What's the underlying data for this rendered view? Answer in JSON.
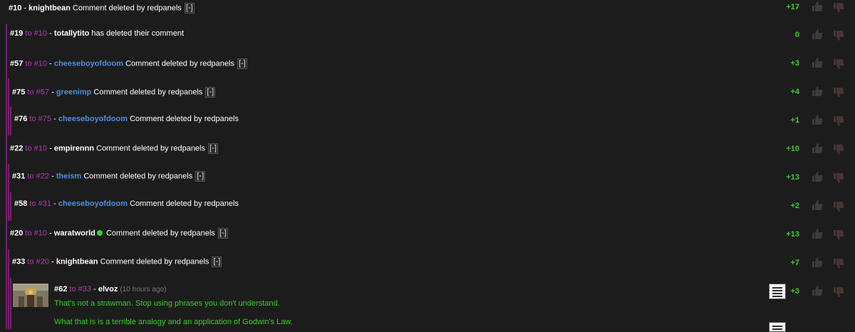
{
  "comments": [
    {
      "num": "#10",
      "to": "",
      "user": "knightbean",
      "user_blue": false,
      "msg": "Comment deleted by redpanels",
      "collapse": "[-]",
      "score": "+17",
      "online": false
    },
    {
      "num": "#19",
      "to": "#10",
      "user": "totallytito",
      "user_blue": false,
      "msg": "has deleted their comment",
      "collapse": "",
      "score": "0",
      "online": false
    },
    {
      "num": "#57",
      "to": "#10",
      "user": "cheeseboyofdoom",
      "user_blue": true,
      "msg": "Comment deleted by redpanels",
      "collapse": "[-]",
      "score": "+3",
      "online": false
    },
    {
      "num": "#75",
      "to": "#57",
      "user": "greenimp",
      "user_blue": true,
      "msg": "Comment deleted by redpanels",
      "collapse": "[-]",
      "score": "+4",
      "online": false
    },
    {
      "num": "#76",
      "to": "#75",
      "user": "cheeseboyofdoom",
      "user_blue": true,
      "msg": "Comment deleted by redpanels",
      "collapse": "",
      "score": "+1",
      "online": false
    },
    {
      "num": "#22",
      "to": "#10",
      "user": "empirennn",
      "user_blue": false,
      "msg": "Comment deleted by redpanels",
      "collapse": "[-]",
      "score": "+10",
      "online": false
    },
    {
      "num": "#31",
      "to": "#22",
      "user": "theism",
      "user_blue": true,
      "msg": "Comment deleted by redpanels",
      "collapse": "[-]",
      "score": "+13",
      "online": false
    },
    {
      "num": "#58",
      "to": "#31",
      "user": "cheeseboyofdoom",
      "user_blue": true,
      "msg": "Comment deleted by redpanels",
      "collapse": "",
      "score": "+2",
      "online": false
    },
    {
      "num": "#20",
      "to": "#10",
      "user": "waratworld",
      "user_blue": false,
      "msg": "Comment deleted by redpanels",
      "collapse": "[-]",
      "score": "+13",
      "online": true
    },
    {
      "num": "#33",
      "to": "#20",
      "user": "knightbean",
      "user_blue": false,
      "msg": "Comment deleted by redpanels",
      "collapse": "[-]",
      "score": "+7",
      "online": false
    }
  ],
  "last_comment": {
    "num": "#62",
    "to": "#33",
    "user": "elvoz",
    "time": "(10 hours ago)",
    "line1": "That's not a strawman. Stop using phrases you don't understand.",
    "line2": "What that is is a terrible analogy and an application of Godwin's Law.",
    "score": "+3"
  },
  "labels": {
    "to": "to",
    "sep": "-"
  },
  "colors": {
    "score": "#3ecb2f",
    "reply_link": "#b33ab0",
    "user_link": "#4d8fdb",
    "thread_bar": "#7a1f6f",
    "online_dot": "#2bd62b"
  },
  "icons": {
    "upvote": "thumbs-up-icon",
    "downvote": "thumbs-down-icon",
    "menu": "menu-lines-icon",
    "collapse": "collapse-icon",
    "online": "online-dot-icon"
  }
}
